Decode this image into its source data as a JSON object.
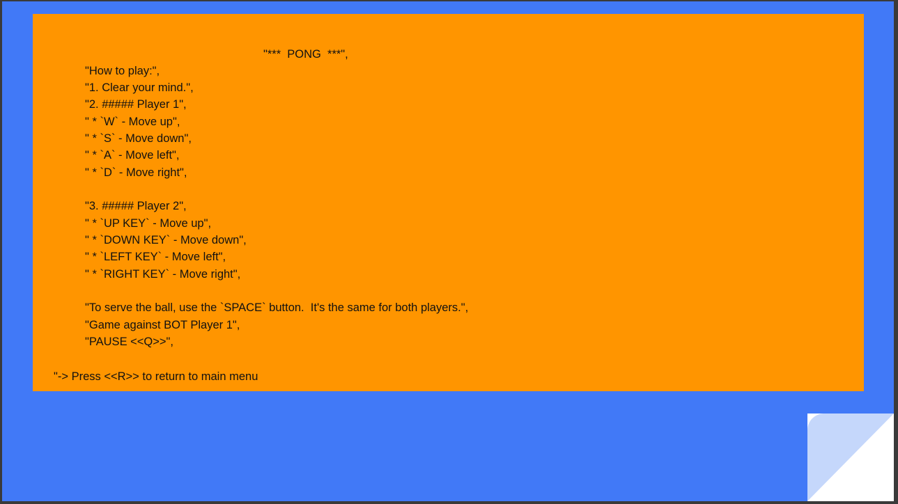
{
  "instructions": {
    "title": "\"***  PONG  ***\",",
    "lines": [
      "\"How to play:\",",
      "\"1. Clear your mind.\",",
      "\"2. ##### Player 1\",",
      "\" * `W` - Move up\",",
      "\" * `S` - Move down\",",
      "\" * `A` - Move left\",",
      "\" * `D` - Move right\",",
      "\"3. ##### Player 2\",",
      "\" * `UP KEY` - Move up\",",
      "\" * `DOWN KEY` - Move down\",",
      "\" * `LEFT KEY` - Move left\",",
      "\" * `RIGHT KEY` - Move right\",",
      "\"To serve the ball, use the `SPACE` button.  It's the same for both players.\",",
      "\"Game against BOT Player 1\",",
      "\"PAUSE <<Q>>\","
    ],
    "footer": "\"-> Press <<R>> to return to main menu"
  },
  "colors": {
    "background": "#4179f7",
    "panel": "#ff9500",
    "text": "#111111",
    "page_curl": "#c5d7fb"
  }
}
